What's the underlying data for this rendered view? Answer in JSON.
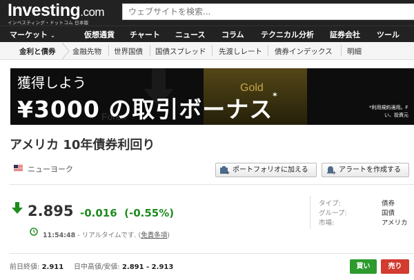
{
  "header": {
    "logo_main": "Investing",
    "logo_suffix": ".com",
    "logo_tagline": "インベスティング・ドットコム 日本版",
    "search_placeholder": "ウェブサイトを検索..."
  },
  "main_nav": [
    {
      "label": "マーケット"
    },
    {
      "label": "仮想通貨"
    },
    {
      "label": "チャート"
    },
    {
      "label": "ニュース"
    },
    {
      "label": "コラム"
    },
    {
      "label": "テクニカル分析"
    },
    {
      "label": "証券会社"
    },
    {
      "label": "ツール"
    }
  ],
  "sub_nav": [
    {
      "label": "金利と債券"
    },
    {
      "label": "金融先物"
    },
    {
      "label": "世界国債"
    },
    {
      "label": "国債スプレッド"
    },
    {
      "label": "先渡しレート"
    },
    {
      "label": "債券インデックス"
    },
    {
      "label": "明細"
    }
  ],
  "banner": {
    "line1": "獲得しよう",
    "line2": "¥3000 の取引ボーナス",
    "asterisk": "*",
    "gold_text": "Gold",
    "forex_text": "Forex",
    "fine_print_1": "*利用規約適用。F",
    "fine_print_2": "い、投資元"
  },
  "instrument": {
    "title": "アメリカ 10年債券利回り",
    "exchange": "ニューヨーク",
    "add_portfolio_label": "ポートフォリオに加える",
    "create_alert_label": "アラートを作成する",
    "price": "2.895",
    "change": "-0.016",
    "change_pct": "(-0.55%)",
    "time": "11:54:48",
    "time_suffix": " - リアルタイムです. (",
    "disclaimer_link": "免責条項",
    "time_close": ")",
    "info": [
      {
        "key": "タイプ:",
        "value": "債券"
      },
      {
        "key": "グループ:",
        "value": "国債"
      },
      {
        "key": "市場:",
        "value": "アメリカ"
      }
    ],
    "prev_close_label": "前日終値:",
    "prev_close_value": "2.911",
    "day_range_label": "日中高値/安値:",
    "day_range_value": "2.891 - 2.913",
    "buy_label": "買い",
    "sell_label": "売り"
  },
  "colors": {
    "header_bg": "#222222",
    "positive_green": "#1e8c1e",
    "buy_green": "#2c9a2c",
    "sell_red": "#d23b30"
  }
}
